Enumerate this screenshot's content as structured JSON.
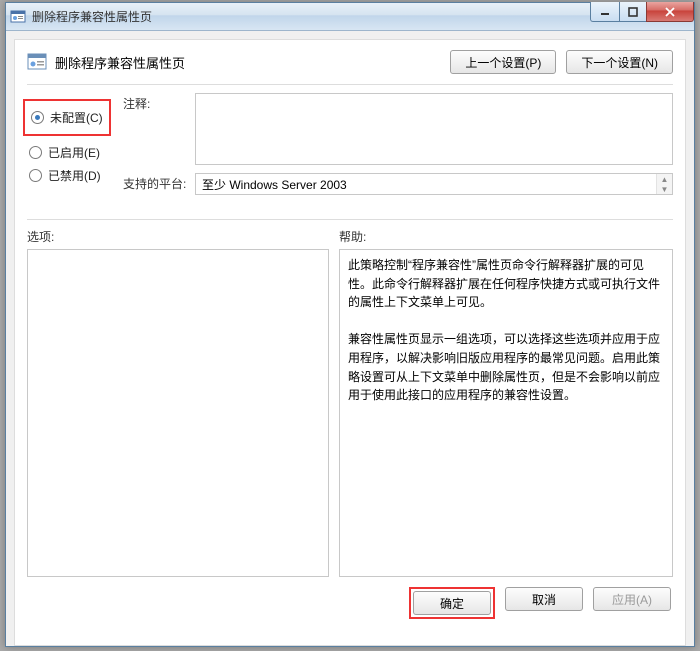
{
  "window": {
    "title": "删除程序兼容性属性页"
  },
  "header": {
    "title": "删除程序兼容性属性页",
    "prev_btn": "上一个设置(P)",
    "next_btn": "下一个设置(N)"
  },
  "radios": {
    "not_configured": "未配置(C)",
    "enabled": "已启用(E)",
    "disabled": "已禁用(D)",
    "selected": "not_configured"
  },
  "fields": {
    "notes_label": "注释:",
    "notes_value": "",
    "platform_label": "支持的平台:",
    "platform_value": "至少 Windows Server 2003"
  },
  "sections": {
    "options_label": "选项:",
    "help_label": "帮助:"
  },
  "help_text": {
    "p1": "此策略控制“程序兼容性”属性页命令行解释器扩展的可见性。此命令行解释器扩展在任何程序快捷方式或可执行文件的属性上下文菜单上可见。",
    "p2": "兼容性属性页显示一组选项，可以选择这些选项并应用于应用程序，以解决影响旧版应用程序的最常见问题。启用此策略设置可从上下文菜单中删除属性页，但是不会影响以前应用于使用此接口的应用程序的兼容性设置。"
  },
  "footer": {
    "ok": "确定",
    "cancel": "取消",
    "apply": "应用(A)"
  }
}
